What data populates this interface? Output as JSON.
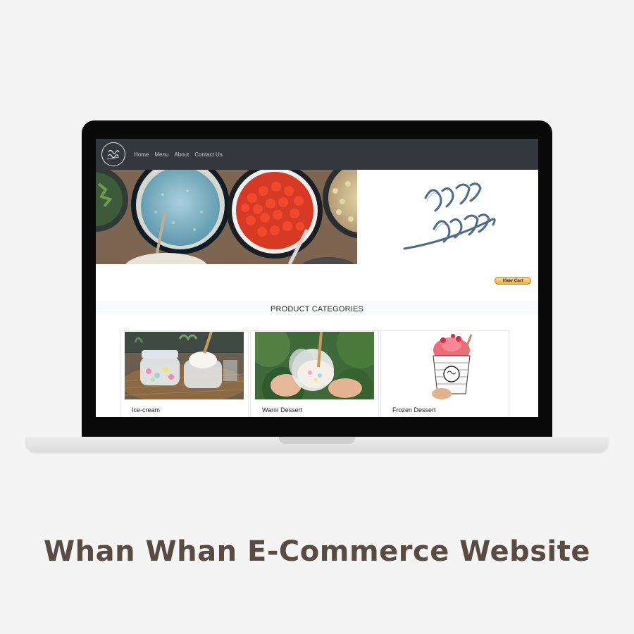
{
  "navbar": {
    "links": [
      "Home",
      "Menu",
      "About",
      "Contact Us"
    ]
  },
  "cart": {
    "label": "View Cart"
  },
  "section": {
    "title": "PRODUCT CATEGORIES"
  },
  "categories": [
    {
      "label": "Ice-cream"
    },
    {
      "label": "Warm Dessert"
    },
    {
      "label": "Frozen Dessert"
    }
  ],
  "caption": "Whan Whan E-Commerce Website",
  "colors": {
    "navbar": "#34373b",
    "caption": "#5a4b42",
    "cart_button": "#f3a93a",
    "logo_script": "#4d6a86"
  }
}
